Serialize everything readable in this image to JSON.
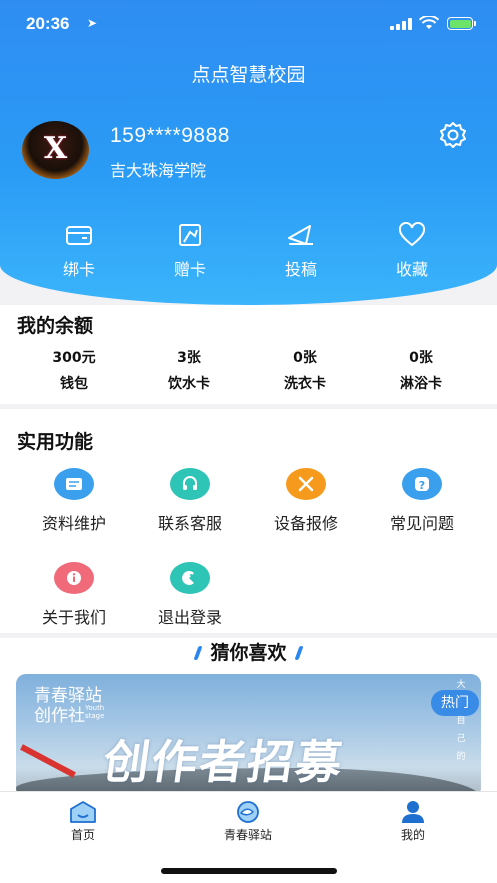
{
  "status_bar": {
    "time": "20:36",
    "location_glyph": "➤"
  },
  "header": {
    "title": "点点智慧校园"
  },
  "profile": {
    "phone": "159****9888",
    "school": "吉大珠海学院",
    "avatar_text": "X"
  },
  "quick_actions": [
    {
      "label": "绑卡",
      "icon": "card-icon"
    },
    {
      "label": "赠卡",
      "icon": "gift-card-icon"
    },
    {
      "label": "投稿",
      "icon": "paper-plane-icon"
    },
    {
      "label": "收藏",
      "icon": "heart-icon"
    }
  ],
  "balance": {
    "title": "我的余额",
    "items": [
      {
        "value": "300元",
        "label": "钱包"
      },
      {
        "value": "3张",
        "label": "饮水卡"
      },
      {
        "value": "0张",
        "label": "洗衣卡"
      },
      {
        "value": "0张",
        "label": "淋浴卡"
      }
    ]
  },
  "functions": {
    "title": "实用功能",
    "items": [
      {
        "label": "资料维护",
        "icon": "profile-card-icon",
        "color": "#3aa0ee"
      },
      {
        "label": "联系客服",
        "icon": "headset-icon",
        "color": "#2ec4b6"
      },
      {
        "label": "设备报修",
        "icon": "tools-icon",
        "color": "#f59a1d"
      },
      {
        "label": "常见问题",
        "icon": "question-icon",
        "color": "#3aa0ee"
      },
      {
        "label": "关于我们",
        "icon": "info-icon",
        "color": "#f06a7a"
      },
      {
        "label": "退出登录",
        "icon": "logout-icon",
        "color": "#2ec4b6"
      }
    ]
  },
  "recommend": {
    "title": "猜你喜欢",
    "banner": {
      "line1": "青春驿站",
      "line2": "创作社",
      "tag": "Youth stage",
      "headline": "创作者招募",
      "side_text": "大 生 自 己 的",
      "hot_label": "热门"
    }
  },
  "tabbar": [
    {
      "label": "首页",
      "icon": "home-icon"
    },
    {
      "label": "青春驿站",
      "icon": "fish-icon"
    },
    {
      "label": "我的",
      "icon": "user-icon"
    }
  ]
}
